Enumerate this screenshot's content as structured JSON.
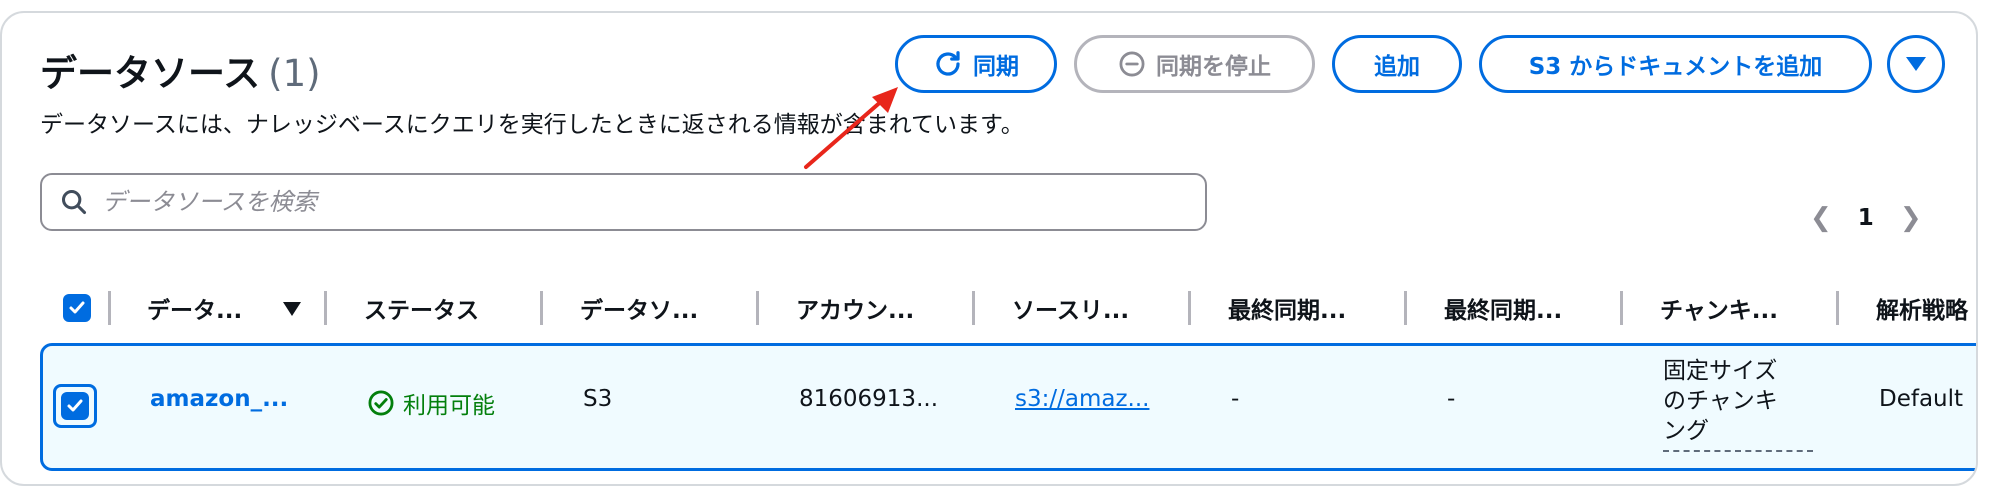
{
  "header": {
    "title": "データソース",
    "count": "(1)",
    "description": "データソースには、ナレッジベースにクエリを実行したときに返される情報が含まれています。"
  },
  "toolbar": {
    "sync_label": "同期",
    "stop_sync_label": "同期を停止",
    "add_label": "追加",
    "add_s3_label": "S3 からドキュメントを追加"
  },
  "search": {
    "placeholder": "データソースを検索"
  },
  "pagination": {
    "current_page": "1"
  },
  "table": {
    "columns": [
      "データ...",
      "ステータス",
      "データソ...",
      "アカウン...",
      "ソースリ...",
      "最終同期...",
      "最終同期...",
      "チャンキ...",
      "解析戦略"
    ],
    "rows": [
      {
        "name": "amazon_...",
        "status": "利用可能",
        "data_source_type": "S3",
        "account": "81606913...",
        "source_link": "s3://amaz...",
        "last_sync_1": "-",
        "last_sync_2": "-",
        "chunking_line1": "固定サイズ",
        "chunking_line2": "のチャンキ",
        "chunking_line3": "ング",
        "parsing": "Default"
      }
    ]
  },
  "colors": {
    "accent": "#006ce0",
    "success": "#037f0c",
    "selected_row_bg": "#f0fbff",
    "annotation_arrow": "#e8261b"
  },
  "icons": [
    "refresh-icon",
    "stop-circle-icon",
    "caret-down-icon",
    "search-icon",
    "chevron-left-icon",
    "chevron-right-icon",
    "check-circle-icon",
    "sort-down-icon"
  ]
}
